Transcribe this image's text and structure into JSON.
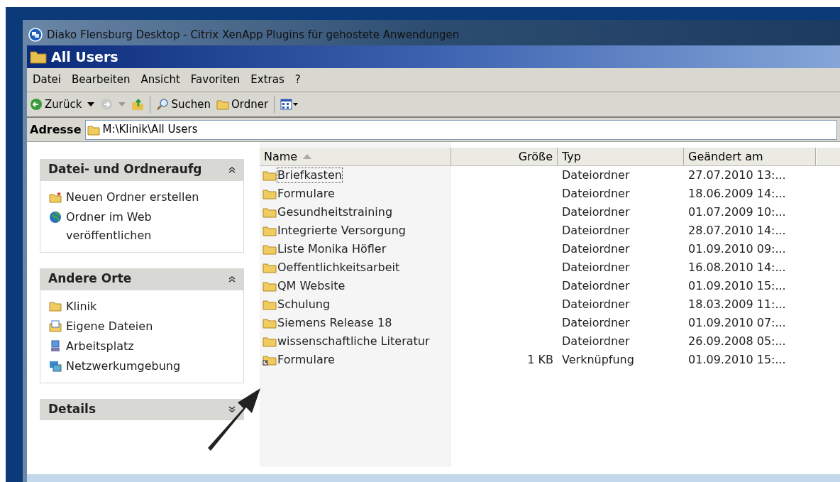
{
  "outer_window": {
    "title": "Diako Flensburg Desktop - Citrix XenApp Plugins für gehostete Anwendungen"
  },
  "window": {
    "title": "All Users"
  },
  "menu": [
    "Datei",
    "Bearbeiten",
    "Ansicht",
    "Favoriten",
    "Extras",
    "?"
  ],
  "toolbar": {
    "back": "Zurück",
    "search": "Suchen",
    "folders": "Ordner"
  },
  "address": {
    "label": "Adresse",
    "value": "M:\\Klinik\\All Users"
  },
  "panels": [
    {
      "title": "Datei- und Ordneraufg",
      "expanded": true,
      "items": [
        {
          "label": "Neuen Ordner erstellen",
          "kind": "newfolder"
        },
        {
          "label": "Ordner im Web veröffentlichen",
          "kind": "globe"
        }
      ]
    },
    {
      "title": "Andere Orte",
      "expanded": true,
      "items": [
        {
          "label": "Klinik",
          "kind": "folder"
        },
        {
          "label": "Eigene Dateien",
          "kind": "docs"
        },
        {
          "label": "Arbeitsplatz",
          "kind": "computer"
        },
        {
          "label": "Netzwerkumgebung",
          "kind": "network"
        }
      ]
    },
    {
      "title": "Details",
      "expanded": false
    }
  ],
  "table": {
    "columns": [
      {
        "label": "Name",
        "sorted": true
      },
      {
        "label": "Größe",
        "sorted": false
      },
      {
        "label": "Typ",
        "sorted": false
      },
      {
        "label": "Geändert am",
        "sorted": false
      }
    ],
    "rows": [
      {
        "kind": "folder",
        "name": "Briefkasten",
        "size": "",
        "type": "Dateiordner",
        "modified": "27.07.2010 13:...",
        "focused": true
      },
      {
        "kind": "folder",
        "name": "Formulare",
        "size": "",
        "type": "Dateiordner",
        "modified": "18.06.2009 14:...",
        "focused": false
      },
      {
        "kind": "folder",
        "name": "Gesundheitstraining",
        "size": "",
        "type": "Dateiordner",
        "modified": "01.07.2009 10:...",
        "focused": false
      },
      {
        "kind": "folder",
        "name": "Integrierte Versorgung",
        "size": "",
        "type": "Dateiordner",
        "modified": "28.07.2010 14:...",
        "focused": false
      },
      {
        "kind": "folder",
        "name": "Liste Monika Höfler",
        "size": "",
        "type": "Dateiordner",
        "modified": "01.09.2010 09:...",
        "focused": false
      },
      {
        "kind": "folder",
        "name": "Oeffentlichkeitsarbeit",
        "size": "",
        "type": "Dateiordner",
        "modified": "16.08.2010 14:...",
        "focused": false
      },
      {
        "kind": "folder",
        "name": "QM Website",
        "size": "",
        "type": "Dateiordner",
        "modified": "01.09.2010 15:...",
        "focused": false
      },
      {
        "kind": "folder",
        "name": "Schulung",
        "size": "",
        "type": "Dateiordner",
        "modified": "18.03.2009 11:...",
        "focused": false
      },
      {
        "kind": "folder",
        "name": "Siemens Release 18",
        "size": "",
        "type": "Dateiordner",
        "modified": "01.09.2010 07:...",
        "focused": false
      },
      {
        "kind": "folder",
        "name": "wissenschaftliche Literatur",
        "size": "",
        "type": "Dateiordner",
        "modified": "26.09.2008 05:...",
        "focused": false
      },
      {
        "kind": "shortcut",
        "name": "Formulare",
        "size": "1 KB",
        "type": "Verknüpfung",
        "modified": "01.09.2010 15:...",
        "focused": false
      }
    ]
  }
}
